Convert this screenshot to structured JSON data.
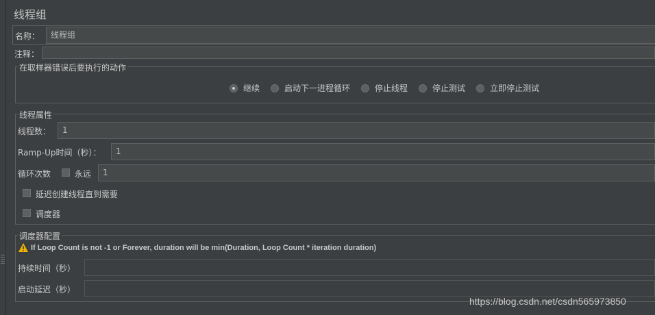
{
  "panel": {
    "title": "线程组"
  },
  "name_row": {
    "label": "名称：",
    "value": "线程组"
  },
  "comment_row": {
    "label": "注释：",
    "value": ""
  },
  "error_action": {
    "legend": "在取样器错误后要执行的动作",
    "options": [
      {
        "label": "继续",
        "selected": true
      },
      {
        "label": "启动下一进程循环",
        "selected": false
      },
      {
        "label": "停止线程",
        "selected": false
      },
      {
        "label": "停止测试",
        "selected": false
      },
      {
        "label": "立即停止测试",
        "selected": false
      }
    ]
  },
  "thread_props": {
    "legend": "线程属性",
    "threads": {
      "label": "线程数：",
      "value": "1"
    },
    "rampup": {
      "label": "Ramp-Up时间（秒）：",
      "value": "1"
    },
    "loop": {
      "label": "循环次数",
      "forever_label": "永远",
      "forever_checked": false,
      "value": "1"
    },
    "delay_create": {
      "label": "延迟创建线程直到需要",
      "checked": false
    },
    "scheduler": {
      "label": "调度器",
      "checked": false
    }
  },
  "scheduler_config": {
    "legend": "调度器配置",
    "warning": "If Loop Count is not -1 or Forever, duration will be min(Duration, Loop Count * iteration duration)",
    "duration": {
      "label": "持续时间（秒）",
      "value": ""
    },
    "startup_delay": {
      "label": "启动延迟（秒）",
      "value": ""
    }
  },
  "watermark": "https://blog.csdn.net/csdn565973850",
  "colors": {
    "background": "#3c3f41",
    "field": "#45494a",
    "border": "#5e6060",
    "warning": "#f0b400"
  }
}
